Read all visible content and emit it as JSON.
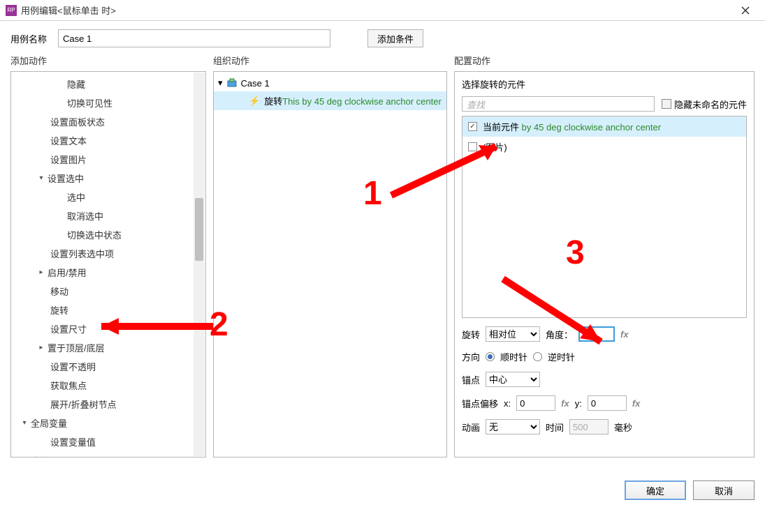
{
  "window": {
    "title": "用例编辑<鼠标单击 时>",
    "app_icon_text": "RP"
  },
  "case_name_label": "用例名称",
  "case_name_value": "Case 1",
  "add_condition_label": "添加条件",
  "columns": {
    "add_action": "添加动作",
    "organize_action": "组织动作",
    "configure_action": "配置动作"
  },
  "action_tree": {
    "items": [
      {
        "label": "隐藏",
        "indent": 3
      },
      {
        "label": "切换可见性",
        "indent": 3
      },
      {
        "label": "设置面板状态",
        "indent": 2
      },
      {
        "label": "设置文本",
        "indent": 2
      },
      {
        "label": "设置图片",
        "indent": 2
      },
      {
        "label": "设置选中",
        "indent": 2,
        "expander": "▾"
      },
      {
        "label": "选中",
        "indent": 3
      },
      {
        "label": "取消选中",
        "indent": 3
      },
      {
        "label": "切换选中状态",
        "indent": 3
      },
      {
        "label": "设置列表选中项",
        "indent": 2
      },
      {
        "label": "启用/禁用",
        "indent": 2,
        "expander": "▸"
      },
      {
        "label": "移动",
        "indent": 2
      },
      {
        "label": "旋转",
        "indent": 2
      },
      {
        "label": "设置尺寸",
        "indent": 2
      },
      {
        "label": "置于顶层/底层",
        "indent": 2,
        "expander": "▸"
      },
      {
        "label": "设置不透明",
        "indent": 2
      },
      {
        "label": "获取焦点",
        "indent": 2
      },
      {
        "label": "展开/折叠树节点",
        "indent": 2
      },
      {
        "label": "全局变量",
        "indent": 1,
        "expander": "▾"
      },
      {
        "label": "设置变量值",
        "indent": 2
      },
      {
        "label": "中继器",
        "indent": 1,
        "expander": "▸"
      }
    ]
  },
  "organize_tree": {
    "case_expander": "▾",
    "case_label": "Case 1",
    "action_label_prefix": "旋转",
    "action_label_detail": "This by 45 deg clockwise anchor center"
  },
  "configure": {
    "section_title": "选择旋转的元件",
    "search_placeholder": "查找",
    "hide_unnamed_label": "隐藏未命名的元件",
    "elements": [
      {
        "label": "当前元件",
        "detail": "by 45 deg clockwise anchor center",
        "checked": true,
        "selected": true
      },
      {
        "label": "(图片)",
        "detail": "",
        "checked": false,
        "selected": false
      }
    ],
    "rotate_label": "旋转",
    "rotate_mode": "相对位",
    "angle_label": "角度：",
    "angle_value": "45",
    "direction_label": "方向",
    "dir_cw": "顺时针",
    "dir_ccw": "逆时针",
    "anchor_label": "锚点",
    "anchor_value": "中心",
    "offset_label": "锚点偏移",
    "offset_x_label": "x:",
    "offset_x_value": "0",
    "offset_y_label": "y:",
    "offset_y_value": "0",
    "anim_label": "动画",
    "anim_value": "无",
    "time_label": "时间",
    "time_value": "500",
    "ms_label": "毫秒"
  },
  "footer": {
    "ok": "确定",
    "cancel": "取消"
  },
  "annotations": {
    "n1": "1",
    "n2": "2",
    "n3": "3"
  }
}
